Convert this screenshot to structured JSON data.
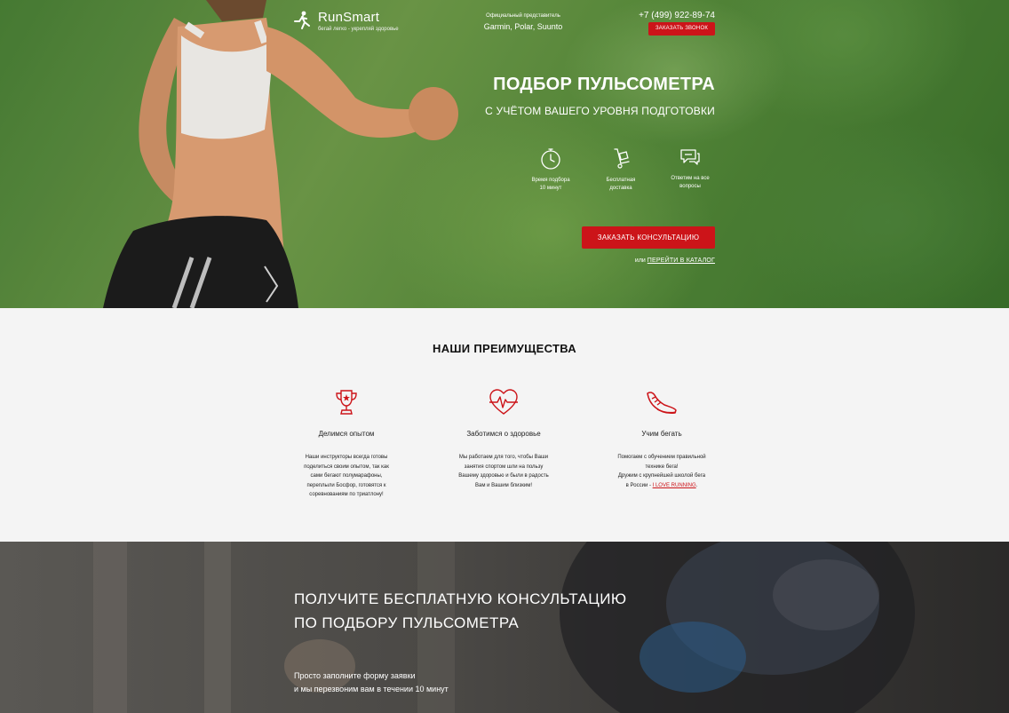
{
  "header": {
    "logo": {
      "name": "RunSmart",
      "tagline": "бегай легко - укрепляй здоровье"
    },
    "dealer": {
      "title": "Официальный представитель",
      "brands": "Garmin, Polar, Suunto"
    },
    "phone": "+7 (499) 922-89-74",
    "callback_label": "ЗАКАЗАТЬ ЗВОНОК"
  },
  "hero": {
    "title": "ПОДБОР ПУЛЬСОМЕТРА",
    "subtitle": "С УЧЁТОМ ВАШЕГО УРОВНЯ ПОДГОТОВКИ",
    "features": [
      {
        "icon": "stopwatch-icon",
        "line1": "Время подбора",
        "line2": "10 минут"
      },
      {
        "icon": "delivery-cart-icon",
        "line1": "Бесплатная",
        "line2": "доставка"
      },
      {
        "icon": "chat-icon",
        "line1": "Ответим на все",
        "line2": "вопросы"
      }
    ],
    "consult_button": "ЗАКАЗАТЬ КОНСУЛЬТАЦИЮ",
    "or_text": "или",
    "catalog_link": "ПЕРЕЙТИ В КАТАЛОГ"
  },
  "advantages": {
    "title": "НАШИ ПРЕИМУЩЕСТВА",
    "items": [
      {
        "icon": "trophy-icon",
        "title": "Делимся опытом",
        "lines": [
          "Наши инструкторы всегда готовы",
          "поделиться своим опытом, так как",
          "сами бегают полумарафоны,",
          "переплыли Босфор, готовятся к",
          "соревнованиям по триатлону!"
        ]
      },
      {
        "icon": "heart-pulse-icon",
        "title": "Заботимся о здоровье",
        "lines": [
          "Мы работаем для того, чтобы Ваши",
          "занятия спортом шли на пользу",
          "Вашему здоровью и были в радость",
          "Вам и Вашим близким!"
        ]
      },
      {
        "icon": "running-shoe-icon",
        "title": "Учим бегать",
        "lines": [
          "Помогаем с обучением правильной",
          "технике бега!",
          "Дружим с крупнейшей школой бега",
          "в России - "
        ],
        "link": "I LOVE RUNNING",
        "after_link": "."
      }
    ]
  },
  "consultation": {
    "title_line1": "ПОЛУЧИТЕ БЕСПЛАТНУЮ КОНСУЛЬТАЦИЮ",
    "title_line2": "ПО ПОДБОРУ ПУЛЬСОМЕТРА",
    "text_line1": "Просто заполните форму заявки",
    "text_line2": "и мы перезвоним вам в течении 10 минут"
  },
  "colors": {
    "accent": "#cc1419",
    "advantages_bg": "#f4f4f4",
    "text_dark": "#222222"
  }
}
